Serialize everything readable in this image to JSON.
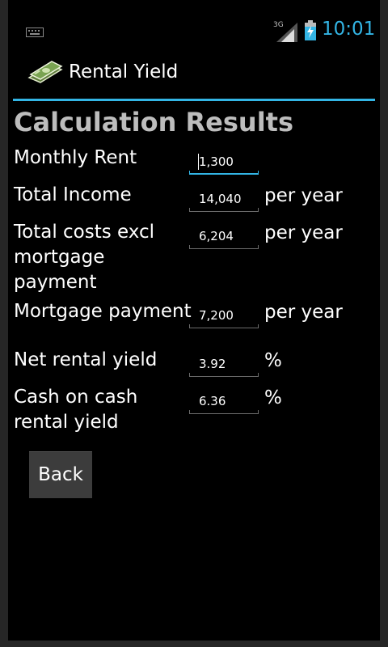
{
  "status_bar": {
    "network": "3G",
    "time": "10:01",
    "accent_color": "#33b5e5"
  },
  "action_bar": {
    "title": "Rental Yield",
    "icon": "money-icon"
  },
  "content": {
    "heading": "Calculation Results",
    "rows": [
      {
        "label": "Monthly Rent",
        "value": "1,300",
        "unit": ""
      },
      {
        "label": "Total Income",
        "value": "14,040",
        "unit": "per year"
      },
      {
        "label": "Total costs excl mortgage payment",
        "value": "6,204",
        "unit": "per year"
      },
      {
        "label": "Mortgage payment",
        "value": "7,200",
        "unit": "per year"
      },
      {
        "label": "Net rental yield",
        "value": "3.92",
        "unit": "%"
      },
      {
        "label": "Cash on cash rental yield",
        "value": "6.36",
        "unit": "%"
      }
    ],
    "back_label": "Back"
  }
}
